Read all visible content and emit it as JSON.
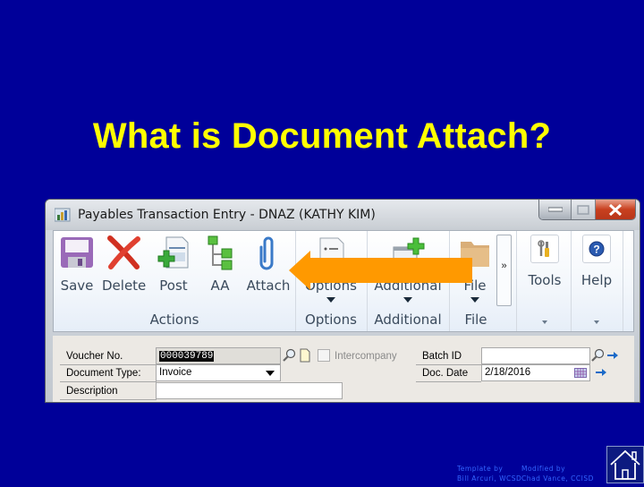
{
  "slide": {
    "title": "What is Document Attach?",
    "background_color": "#000099",
    "title_color": "#ffff00",
    "credits": {
      "template_label": "Template by",
      "template_author": "Bill Arcuri, WCSD",
      "modified_label": "Modified by",
      "modified_author": "Chad Vance, CCISD"
    },
    "home_button_icon": "home-icon"
  },
  "window": {
    "title": "Payables Transaction Entry  -  DNAZ (KATHY KIM)",
    "controls": [
      "minimize",
      "maximize",
      "close"
    ]
  },
  "ribbon": {
    "groups": [
      {
        "label": "Actions",
        "buttons": [
          {
            "label": "Save",
            "icon": "floppy-disk-icon"
          },
          {
            "label": "Delete",
            "icon": "red-x-icon"
          },
          {
            "label": "Post",
            "icon": "post-document-icon"
          },
          {
            "label": "AA",
            "icon": "hierarchy-icon"
          },
          {
            "label": "Attach",
            "icon": "paperclip-icon"
          }
        ]
      },
      {
        "label": "Options",
        "buttons": [
          {
            "label": "Options",
            "icon": "options-document-icon",
            "dropdown": true
          }
        ]
      },
      {
        "label": "Additional",
        "buttons": [
          {
            "label": "Additional",
            "icon": "additional-window-icon",
            "dropdown": true
          }
        ]
      },
      {
        "label": "File",
        "buttons": [
          {
            "label": "File",
            "icon": "folder-icon",
            "dropdown": true
          }
        ]
      },
      {
        "label": "",
        "buttons": [
          {
            "label": "Tools",
            "icon": "tools-icon"
          }
        ]
      },
      {
        "label": "",
        "buttons": [
          {
            "label": "Help",
            "icon": "help-icon"
          }
        ]
      }
    ],
    "overflow_label": "»"
  },
  "form": {
    "voucher_no": {
      "label": "Voucher No.",
      "value": "000039789"
    },
    "document_type": {
      "label": "Document Type:",
      "value": "Invoice"
    },
    "description": {
      "label": "Description",
      "value": ""
    },
    "intercompany": {
      "label": "Intercompany",
      "checked": false
    },
    "batch_id": {
      "label": "Batch ID",
      "value": ""
    },
    "doc_date": {
      "label": "Doc. Date",
      "value": "2/18/2016"
    }
  },
  "annotation": {
    "type": "arrow-left",
    "color": "#ff9900",
    "points_to": "Attach"
  }
}
